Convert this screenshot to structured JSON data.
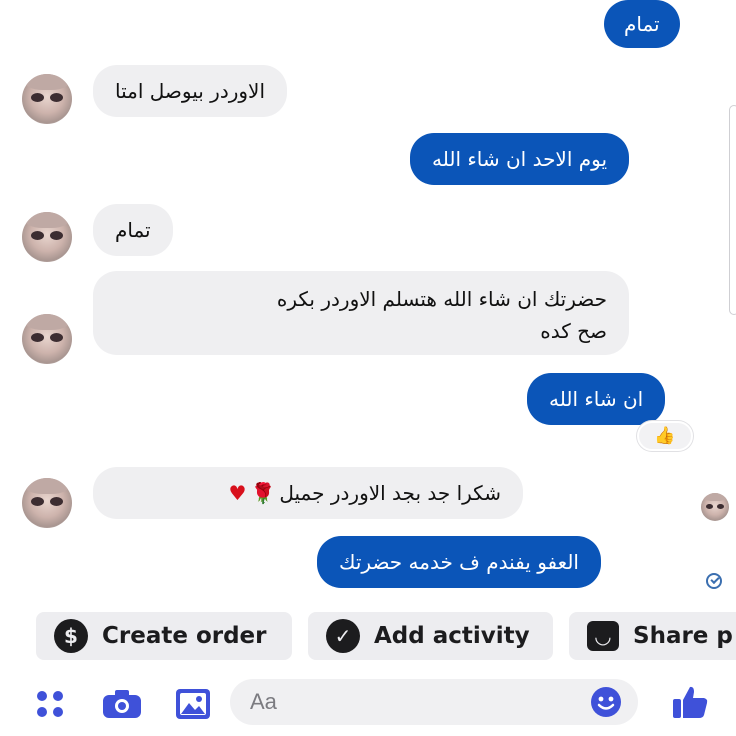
{
  "conversation": {
    "messages": [
      {
        "side": "outgoing",
        "text": "تمام"
      },
      {
        "side": "incoming",
        "text": "الاوردر بيوصل امتا"
      },
      {
        "side": "outgoing",
        "text": "يوم الاحد ان شاء الله"
      },
      {
        "side": "incoming",
        "text": "تمام"
      },
      {
        "side": "incoming",
        "text": "حضرتك ان شاء الله هتسلم الاوردر بكره\nصح كده"
      },
      {
        "side": "outgoing",
        "text": "ان شاء الله",
        "reaction": "👍"
      },
      {
        "side": "incoming",
        "text": "شكرا جد بجد الاوردر جميل",
        "emojis": [
          "🌹",
          "♥"
        ]
      },
      {
        "side": "outgoing",
        "text": "العفو يفندم ف خدمه حضرتك"
      }
    ]
  },
  "quick_actions": [
    {
      "label": "Create order",
      "icon": "dollar-icon"
    },
    {
      "label": "Add activity",
      "icon": "check-circle-icon"
    },
    {
      "label": "Share p",
      "icon": "shopping-bag-icon"
    }
  ],
  "composer": {
    "placeholder": "Aa",
    "icons": [
      "apps-icon",
      "camera-icon",
      "gallery-icon",
      "emoji-icon",
      "thumbs-up-icon"
    ]
  },
  "colors": {
    "outgoing_bubble": "#0b55b8",
    "incoming_bubble": "#efeff1",
    "accent": "#3f51d9"
  }
}
